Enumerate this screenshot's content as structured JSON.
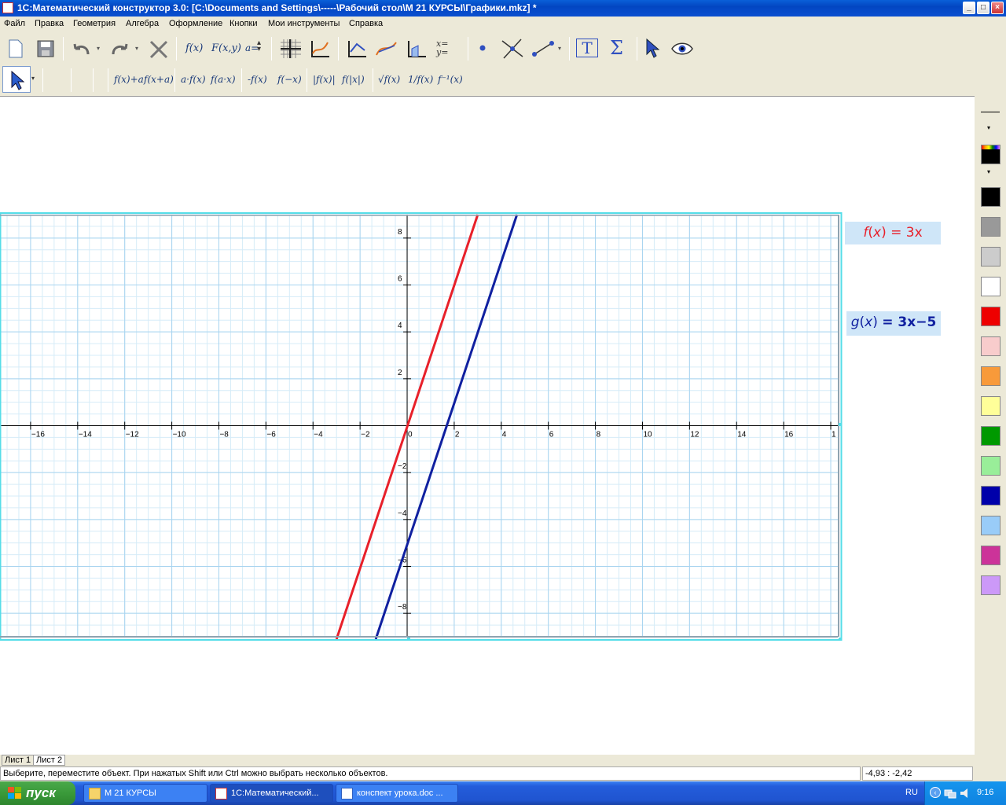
{
  "window": {
    "title": "1С:Математический конструктор 3.0: [C:\\Documents and Settings\\-----\\Рабочий стол\\М 21 КУРСЫ\\Графики.mkz] *",
    "minimize_label": "_",
    "maximize_label": "□",
    "close_label": "×"
  },
  "menu": [
    "Файл",
    "Правка",
    "Геометрия",
    "Алгебра",
    "Оформление",
    "Кнопки",
    "Мои инструменты",
    "Справка"
  ],
  "toolbar2": {
    "f_plus_a": "f(x)+a",
    "f_x_plus_a": "f(x+a)",
    "a_f": "a·f(x)",
    "f_ax": "f(a·x)",
    "neg_f": "-f(x)",
    "f_neg_x": "f(−x)",
    "abs_f": "|f(x)|",
    "f_abs_x": "f(|x|)",
    "sqrt_f": "√f(x)",
    "inv_f": "1/f(x)",
    "f_inverse": "f⁻¹(x)"
  },
  "toolbar1": {
    "fx": "f(x)",
    "Fxy": "F(x,y)",
    "a_eq": "a=",
    "sigma": "Σ",
    "text_tool": "T"
  },
  "formulas": {
    "f": {
      "name": "f",
      "arg": "x",
      "rhs": "= 3x",
      "color": "#e8202a"
    },
    "g": {
      "name": "g",
      "arg": "x",
      "rhs": "= 3x−5",
      "color": "#1020a0"
    }
  },
  "chart_data": {
    "type": "line",
    "xlim": [
      -17.3,
      18.3
    ],
    "ylim": [
      -9.0,
      9.0
    ],
    "grid": true,
    "x_ticks": [
      "−16",
      "−14",
      "−12",
      "−10",
      "−8",
      "−6",
      "−4",
      "−2",
      "0",
      "2",
      "4",
      "6",
      "8",
      "10",
      "12",
      "14",
      "16",
      "1"
    ],
    "y_ticks": [
      "8",
      "6",
      "4",
      "2",
      "−2",
      "−4",
      "−6",
      "−8"
    ],
    "series": [
      {
        "name": "f(x) = 3x",
        "slope": 3,
        "intercept": 0,
        "color": "#e8202a"
      },
      {
        "name": "g(x) = 3x−5",
        "slope": 3,
        "intercept": -5,
        "color": "#1020a0"
      }
    ]
  },
  "palette": [
    "#000000",
    "#999999",
    "#cccccc",
    "#ffffff",
    "#ee0000",
    "#f8cccc",
    "#f89a3a",
    "#ffff99",
    "#009900",
    "#99ee99",
    "#0000aa",
    "#99ccf8",
    "#cc3399",
    "#cc99f8"
  ],
  "sheets": [
    "Лист 1",
    "Лист 2"
  ],
  "status": {
    "message": "Выберите, переместите объект. При нажатых Shift или Ctrl можно выбрать несколько объектов.",
    "coords": "-4,93 : -2,42"
  },
  "taskbar": {
    "start": "пуск",
    "tasks": [
      "М 21 КУРСЫ",
      "1С:Математический...",
      "конспект урока.doc ..."
    ],
    "lang": "RU",
    "time": "9:16"
  }
}
